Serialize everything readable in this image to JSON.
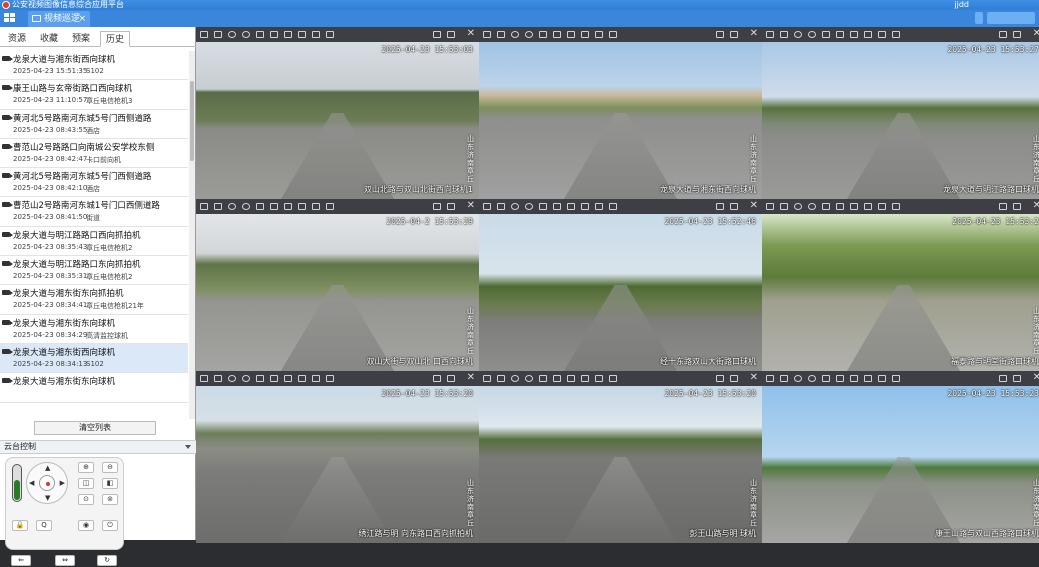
{
  "app": {
    "title": "公安视频图像信息综合应用平台",
    "user": "jjdd"
  },
  "tabbar": {
    "tab_label": "视频巡逻",
    "close": "×"
  },
  "left_tabs": [
    "资源",
    "收藏",
    "预案",
    "历史"
  ],
  "records": [
    {
      "name": "龙泉大道与湘东街西向球机",
      "time": "2025-04-23 15:51:35",
      "code": "S102"
    },
    {
      "name": "康王山路与玄帝街路口西向球机",
      "time": "2025-04-23 11:10:57",
      "code": "章丘电信枪机3"
    },
    {
      "name": "黄河北5号路南河东城5号门西侧道路",
      "time": "2025-04-23 08:43:55",
      "code": "酒店"
    },
    {
      "name": "曹范山2号路路口向南城公安学校东侧",
      "time": "2025-04-23 08:42:47",
      "code": "卡口前向机"
    },
    {
      "name": "黄河北5号路南河东城5号门西侧道路",
      "time": "2025-04-23 08:42:10",
      "code": "酒店"
    },
    {
      "name": "曹范山2号路南河东城1号门口西侧道路",
      "time": "2025-04-23 08:41:50",
      "code": "街道"
    },
    {
      "name": "龙泉大道与明江路路口西向抓拍机",
      "time": "2025-04-23 08:35:43",
      "code": "章丘电信枪机2"
    },
    {
      "name": "龙泉大道与明江路路口东向抓拍机",
      "time": "2025-04-23 08:35:31",
      "code": "章丘电信枪机2"
    },
    {
      "name": "龙泉大道与湘东街东向抓拍机",
      "time": "2025-04-23 08:34:41",
      "code": "章丘电信枪机21年"
    },
    {
      "name": "龙泉大道与湘东街东向球机",
      "time": "2025-04-23 08:34:29",
      "code": "高清监控球机"
    },
    {
      "name": "龙泉大道与湘东街西向球机",
      "time": "2025-04-23 08:34:13",
      "code": "S102"
    },
    {
      "name": "龙泉大道与湘东街东向球机",
      "time": "",
      "code": ""
    }
  ],
  "clear_label": "清空列表",
  "ptz_title": "云台控制",
  "ptz_buttons": [
    "⊕",
    "⊖",
    "◫",
    "◧",
    "⊙",
    "⊚",
    "🔒",
    "Q",
    "◉",
    "⏻"
  ],
  "ptz_footer": [
    "⇐",
    "⇔",
    "↻"
  ],
  "cameras": [
    {
      "time": "2025-04-23 15:53:03",
      "name": "双山北路与双山北街西向球机1",
      "loc": "山东济南章丘"
    },
    {
      "time": "",
      "name": "龙泉大道与湘东街西向球机",
      "loc": "山东济南章丘"
    },
    {
      "time": "2025-04-23 15:53:27",
      "name": "龙泉大道与明江路路口球机",
      "loc": "山东济南章丘"
    },
    {
      "time": "2025-04-2  15:53:29",
      "name": "双山大街与双山北 口西向球机",
      "loc": "山东济南章丘"
    },
    {
      "time": "2025-04-23 15:52:46",
      "name": "经十东路双山大街路口球机",
      "loc": ""
    },
    {
      "time": "2025-04-23 15:53:2",
      "name": "福泰路与明堂街路口球机",
      "loc": "山东济南章丘"
    },
    {
      "time": "2025-04-23 15:53:20",
      "name": "绣江路与明 向东路口西向抓拍机",
      "loc": "山东济南章丘"
    },
    {
      "time": "2025-04-23 15:53:20",
      "name": "彭王山路与明   球机",
      "loc": "山东济南章丘"
    },
    {
      "time": "2025-04-23 15:53:23",
      "name": "康王山路与双山西路路口球机",
      "loc": "山东济南章丘"
    }
  ],
  "colors": {
    "title_blue": "#3a86dd",
    "active_border": "#ffd400",
    "selected_row": "#dbe8f8"
  }
}
